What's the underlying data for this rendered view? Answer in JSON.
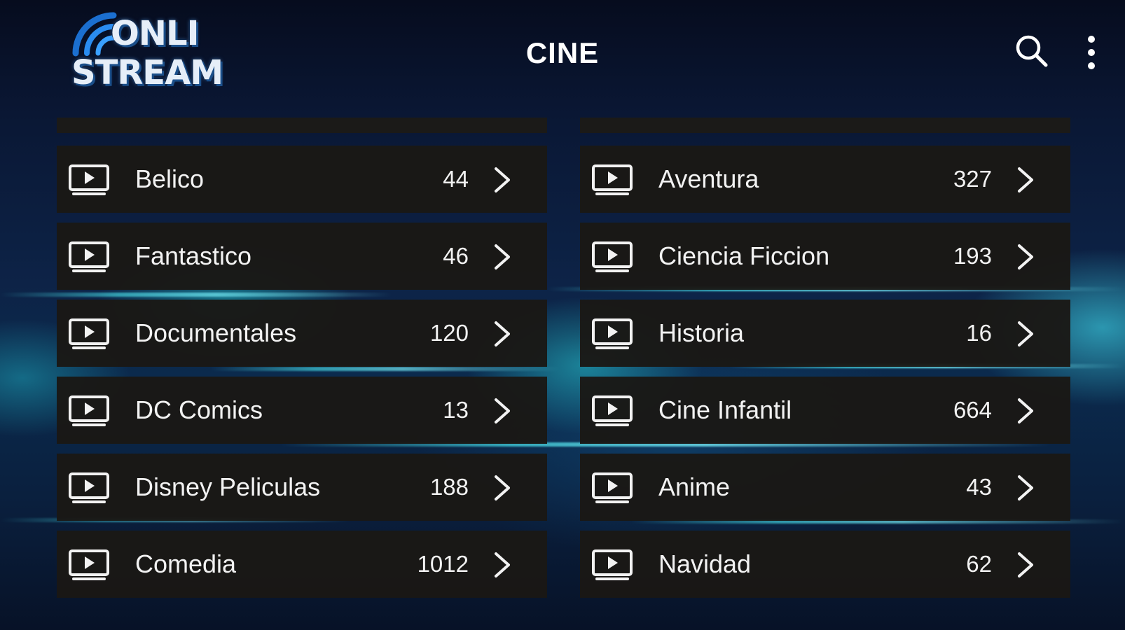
{
  "app": {
    "logo_line1": "ONLI",
    "logo_line2": "STREAM",
    "logo_icon": "wifi-signal-icon"
  },
  "header": {
    "title": "CINE",
    "search_icon": "search-icon",
    "menu_icon": "more-vertical-icon"
  },
  "colors": {
    "row_background": "#1a1815",
    "text": "#f2f2f2",
    "accent_cyan": "#46dce6",
    "logo_blue": "#1b6fd0"
  },
  "categories_left": [
    {
      "label": "Belico",
      "count": "44",
      "icon": "play-screen-icon"
    },
    {
      "label": "Fantastico",
      "count": "46",
      "icon": "play-screen-icon"
    },
    {
      "label": "Documentales",
      "count": "120",
      "icon": "play-screen-icon"
    },
    {
      "label": "DC Comics",
      "count": "13",
      "icon": "play-screen-icon"
    },
    {
      "label": "Disney Peliculas",
      "count": "188",
      "icon": "play-screen-icon"
    },
    {
      "label": "Comedia",
      "count": "1012",
      "icon": "play-screen-icon"
    }
  ],
  "categories_right": [
    {
      "label": "Aventura",
      "count": "327",
      "icon": "play-screen-icon"
    },
    {
      "label": "Ciencia Ficcion",
      "count": "193",
      "icon": "play-screen-icon"
    },
    {
      "label": "Historia",
      "count": "16",
      "icon": "play-screen-icon"
    },
    {
      "label": "Cine Infantil",
      "count": "664",
      "icon": "play-screen-icon"
    },
    {
      "label": "Anime",
      "count": "43",
      "icon": "play-screen-icon"
    },
    {
      "label": "Navidad",
      "count": "62",
      "icon": "play-screen-icon"
    }
  ]
}
